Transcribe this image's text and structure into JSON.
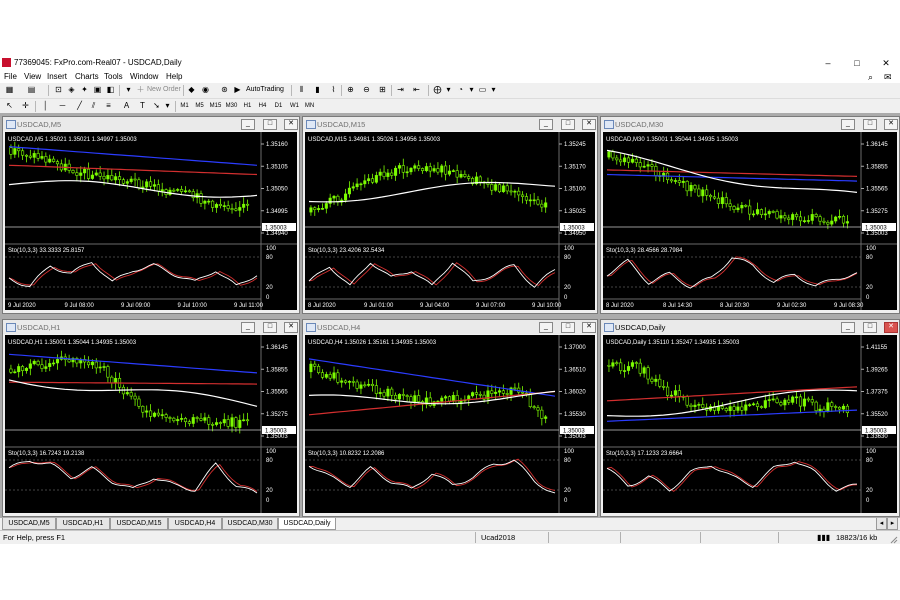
{
  "window": {
    "title": "77369045: FxPro.com-Real07 - USDCAD,Daily",
    "controls": {
      "minimize": "–",
      "maximize": "□",
      "close": "✕"
    }
  },
  "menu": [
    "File",
    "View",
    "Insert",
    "Charts",
    "Tools",
    "Window",
    "Help"
  ],
  "toolbar": {
    "new_order": "New Order",
    "autotrading": "AutoTrading",
    "timeframes": [
      "M1",
      "M5",
      "M15",
      "M30",
      "H1",
      "H4",
      "D1",
      "W1",
      "MN"
    ]
  },
  "charts": [
    {
      "title": "USDCAD,M5",
      "ohlc": "USDCAD,M5  1.35021 1.35021 1.34997 1.35003",
      "current_price": "1.35003",
      "price_ticks": [
        "1.35160",
        "1.35105",
        "1.35050",
        "1.34995",
        "1.34940"
      ],
      "osc_label": "Sto(10,3,3) 33.3333 25.8157",
      "osc_ticks": [
        "80",
        "20",
        "0"
      ],
      "osc_top": "100",
      "time_labels": [
        "9 Jul 2020",
        "9 Jul 08:00",
        "9 Jul 09:00",
        "9 Jul 10:00",
        "9 Jul 11:00"
      ]
    },
    {
      "title": "USDCAD,M15",
      "ohlc": "USDCAD,M15  1.34981 1.35026 1.34956 1.35003",
      "current_price": "1.35003",
      "price_ticks": [
        "1.35245",
        "1.35170",
        "1.35100",
        "1.35025",
        "1.34950"
      ],
      "osc_label": "Sto(10,3,3) 23.4206 32.5434",
      "osc_ticks": [
        "80",
        "20",
        "0"
      ],
      "osc_top": "100",
      "time_labels": [
        "8 Jul 2020",
        "9 Jul 01:00",
        "9 Jul 04:00",
        "9 Jul 07:00",
        "9 Jul 10:00"
      ]
    },
    {
      "title": "USDCAD,M30",
      "ohlc": "USDCAD,M30  1.35001 1.35044 1.34935 1.35003",
      "current_price": "1.35003",
      "price_ticks": [
        "1.36145",
        "1.35855",
        "1.35565",
        "1.35275",
        "1.35003"
      ],
      "osc_label": "Sto(10,3,3) 28.4566 28.7984",
      "osc_ticks": [
        "80",
        "20",
        "0"
      ],
      "osc_top": "100",
      "time_labels": [
        "8 Jul 2020",
        "8 Jul 14:30",
        "8 Jul 20:30",
        "9 Jul 02:30",
        "9 Jul 08:30"
      ]
    },
    {
      "title": "USDCAD,H1",
      "ohlc": "USDCAD,H1  1.35001 1.35044 1.34935 1.35003",
      "current_price": "1.35003",
      "price_ticks": [
        "1.36145",
        "1.35855",
        "1.35565",
        "1.35275",
        "1.35003"
      ],
      "osc_label": "Sto(10,3,3) 16.7243 19.2138",
      "osc_ticks": [
        "100",
        "80",
        "20",
        "0"
      ],
      "osc_top": "",
      "time_labels": []
    },
    {
      "title": "USDCAD,H4",
      "ohlc": "USDCAD,H4  1.35026 1.35161 1.34935 1.35003",
      "current_price": "1.35003",
      "price_ticks": [
        "1.37000",
        "1.36510",
        "1.36020",
        "1.35530",
        "1.35003"
      ],
      "osc_label": "Sto(10,3,3) 10.8232 12.2086",
      "osc_ticks": [
        "100",
        "80",
        "20",
        "0"
      ],
      "osc_top": "",
      "time_labels": []
    },
    {
      "title": "USDCAD,Daily",
      "ohlc": "USDCAD,Daily  1.35110 1.35247 1.34935 1.35003",
      "current_price": "1.35003",
      "price_ticks": [
        "1.41155",
        "1.39265",
        "1.37375",
        "1.35520",
        "1.33630"
      ],
      "osc_label": "Sto(10,3,3) 17.1233 23.6664",
      "osc_ticks": [
        "100",
        "80",
        "20",
        "0"
      ],
      "osc_top": "",
      "time_labels": []
    }
  ],
  "tabs": [
    "USDCAD,M5",
    "USDCAD,H1",
    "USDCAD,M15",
    "USDCAD,H4",
    "USDCAD,M30",
    "USDCAD,Daily"
  ],
  "active_tab": "USDCAD,Daily",
  "status": {
    "help": "For Help, press F1",
    "profile": "Ucad2018",
    "traffic": "18823/16 kb"
  },
  "colors": {
    "chart_bg": "#000000",
    "candle": "#7cfc00",
    "ma_blue": "#2b3cff",
    "ma_red": "#d32f2f",
    "ma_white": "#ffffff",
    "sto_main": "#ffffff",
    "sto_signal": "#d32f2f"
  }
}
